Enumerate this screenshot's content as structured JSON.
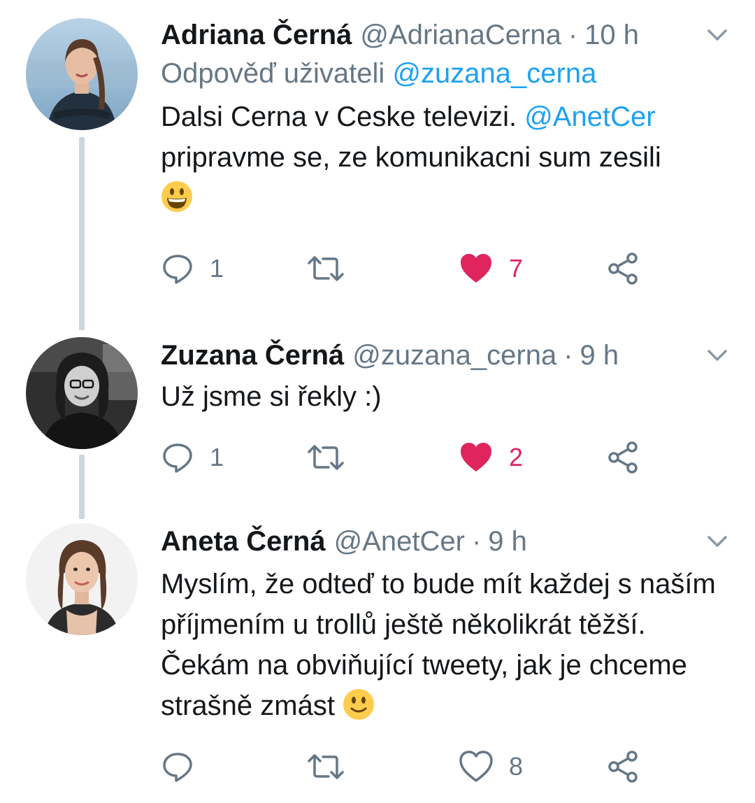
{
  "colors": {
    "link": "#1da1f2",
    "muted": "#657786",
    "like": "#e0245e",
    "thread_line": "#ccd6dd"
  },
  "tweets": [
    {
      "name": "Adriana Černá",
      "handle": "@AdrianaCerna",
      "separator": "·",
      "time": "10 h",
      "reply_prefix": "Odpověď uživateli",
      "reply_mention": "@zuzana_cerna",
      "text_part1": "Dalsi Cerna v Ceske televizi.",
      "text_mention": "@AnetCer",
      "text_part2": "pripravme se, ze komunikacni sum zesili",
      "emoji": "grinning-face-emoji",
      "reply_count": "1",
      "retweet_count": "",
      "like_count": "7",
      "liked": true
    },
    {
      "name": "Zuzana Černá",
      "handle": "@zuzana_cerna",
      "separator": "·",
      "time": "9 h",
      "text": "Už jsme si řekly :)",
      "reply_count": "1",
      "retweet_count": "",
      "like_count": "2",
      "liked": true
    },
    {
      "name": "Aneta Černá",
      "handle": "@AnetCer",
      "separator": "·",
      "time": "9 h",
      "text": "Myslím, že odteď to bude mít každej s naším příjmením u trollů ještě několikrát těžší. Čekám na obviňující tweety, jak je chceme strašně zmást",
      "emoji": "slightly-smiling-face-emoji",
      "reply_count": "",
      "retweet_count": "",
      "like_count": "8",
      "liked": false
    }
  ],
  "icons": {
    "reply": "reply-icon",
    "retweet": "retweet-icon",
    "like": "heart-icon",
    "share": "share-icon",
    "caret": "chevron-down-icon"
  }
}
